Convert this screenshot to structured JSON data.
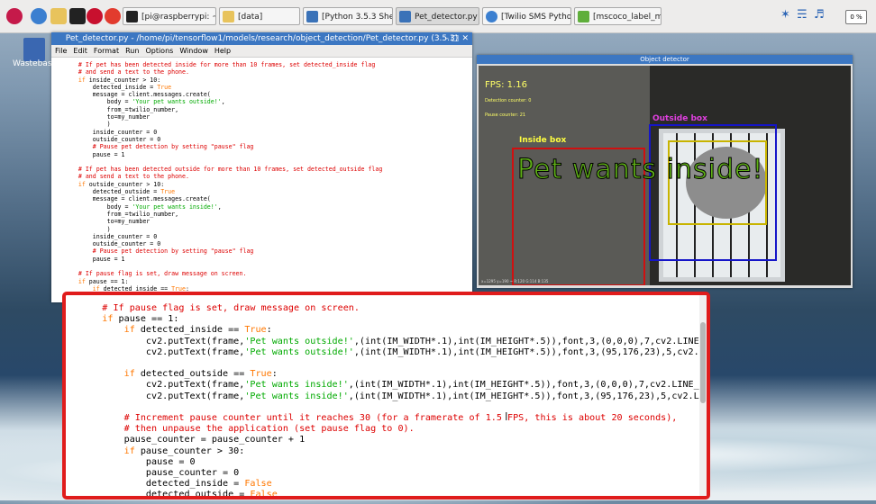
{
  "taskbar": {
    "tasks": [
      "[pi@raspberrypi: ~/te...",
      "[data]",
      "[Python 3.5.3 Shell]",
      "Pet_detector.py - /ho...",
      "[Twilio SMS Python Q...",
      "[mscoco_label_map.p..."
    ],
    "volume_label": "0 %"
  },
  "desktop": {
    "icon_label": "Wastebasket"
  },
  "editor": {
    "title": "Pet_detector.py - /home/pi/tensorflow1/models/research/object_detection/Pet_detector.py (3.5.3)",
    "menu": [
      "File",
      "Edit",
      "Format",
      "Run",
      "Options",
      "Window",
      "Help"
    ],
    "lines": [
      [
        [
          "c",
          "    # If pet has been detected inside for more than 10 frames, set detected_inside flag"
        ]
      ],
      [
        [
          "c",
          "    # and send a text to the phone."
        ]
      ],
      [
        [
          "k",
          "    if "
        ],
        [
          "n",
          "inside_counter > 10:"
        ]
      ],
      [
        [
          "n",
          "        detected_inside = "
        ],
        [
          "k",
          "True"
        ]
      ],
      [
        [
          "n",
          "        message = client.messages.create("
        ]
      ],
      [
        [
          "n",
          "            body = "
        ],
        [
          "s",
          "'Your pet wants outside!'"
        ],
        [
          "n",
          ","
        ]
      ],
      [
        [
          "n",
          "            from_=twilio_number,"
        ]
      ],
      [
        [
          "n",
          "            to=my_number"
        ]
      ],
      [
        [
          "n",
          "            )"
        ]
      ],
      [
        [
          "n",
          "        inside_counter = 0"
        ]
      ],
      [
        [
          "n",
          "        outside_counter = 0"
        ]
      ],
      [
        [
          "c",
          "        # Pause pet detection by setting \"pause\" flag"
        ]
      ],
      [
        [
          "n",
          "        pause = 1"
        ]
      ],
      [
        [
          "n",
          ""
        ]
      ],
      [
        [
          "c",
          "    # If pet has been detected outside for more than 10 frames, set detected_outside flag"
        ]
      ],
      [
        [
          "c",
          "    # and send a text to the phone."
        ]
      ],
      [
        [
          "k",
          "    if "
        ],
        [
          "n",
          "outside_counter > 10:"
        ]
      ],
      [
        [
          "n",
          "        detected_outside = "
        ],
        [
          "k",
          "True"
        ]
      ],
      [
        [
          "n",
          "        message = client.messages.create("
        ]
      ],
      [
        [
          "n",
          "            body = "
        ],
        [
          "s",
          "'Your pet wants inside!'"
        ],
        [
          "n",
          ","
        ]
      ],
      [
        [
          "n",
          "            from_=twilio_number,"
        ]
      ],
      [
        [
          "n",
          "            to=my_number"
        ]
      ],
      [
        [
          "n",
          "            )"
        ]
      ],
      [
        [
          "n",
          "        inside_counter = 0"
        ]
      ],
      [
        [
          "n",
          "        outside_counter = 0"
        ]
      ],
      [
        [
          "c",
          "        # Pause pet detection by setting \"pause\" flag"
        ]
      ],
      [
        [
          "n",
          "        pause = 1"
        ]
      ],
      [
        [
          "n",
          ""
        ]
      ],
      [
        [
          "c",
          "    # If pause flag is set, draw message on screen."
        ]
      ],
      [
        [
          "k",
          "    if "
        ],
        [
          "n",
          "pause == 1:"
        ]
      ],
      [
        [
          "k",
          "        if "
        ],
        [
          "n",
          "detected_inside == "
        ],
        [
          "k",
          "True"
        ],
        [
          "n",
          ":"
        ]
      ],
      [
        [
          "n",
          "            cv2.putText(frame,"
        ],
        [
          "s",
          "'Pet wants outside!'"
        ],
        [
          "n",
          ",(int(IM_WIDTH*.1),int(IM_HEIGHT*.5)),font,3,(0,0,0),7,cv2.LINE_A"
        ]
      ],
      [
        [
          "n",
          "            cv2.putText(frame,"
        ],
        [
          "s",
          "'Pet wants outside!'"
        ],
        [
          "n",
          ",(int(IM_WIDTH*.1),int(IM_HEIGHT*.5)),font,3,(95,176,23),5,cv2.L"
        ]
      ]
    ]
  },
  "detector": {
    "title": "Object detector",
    "fps": "FPS: 1.16",
    "detection_counter": "Detection counter: 0",
    "pause_counter": "Pause counter: 21",
    "outside_box_label": "Outside box",
    "inside_box_label": "Inside box",
    "message": "Pet wants inside!",
    "status": "x=1295 y=190 ~ R:120 G:114 B:135"
  },
  "callout": {
    "lines": [
      [
        [
          "c",
          "    # If pause flag is set, draw message on screen."
        ]
      ],
      [
        [
          "k",
          "    if "
        ],
        [
          "n",
          "pause == 1:"
        ]
      ],
      [
        [
          "k",
          "        if "
        ],
        [
          "n",
          "detected_inside == "
        ],
        [
          "k",
          "True"
        ],
        [
          "n",
          ":"
        ]
      ],
      [
        [
          "n",
          "            cv2.putText(frame,"
        ],
        [
          "s",
          "'Pet wants outside!'"
        ],
        [
          "n",
          ",(int(IM_WIDTH*.1),int(IM_HEIGHT*.5)),font,3,(0,0,0),7,cv2.LINE_A"
        ]
      ],
      [
        [
          "n",
          "            cv2.putText(frame,"
        ],
        [
          "s",
          "'Pet wants outside!'"
        ],
        [
          "n",
          ",(int(IM_WIDTH*.1),int(IM_HEIGHT*.5)),font,3,(95,176,23),5,cv2.L"
        ]
      ],
      [
        [
          "n",
          ""
        ]
      ],
      [
        [
          "k",
          "        if "
        ],
        [
          "n",
          "detected_outside == "
        ],
        [
          "k",
          "True"
        ],
        [
          "n",
          ":"
        ]
      ],
      [
        [
          "n",
          "            cv2.putText(frame,"
        ],
        [
          "s",
          "'Pet wants inside!'"
        ],
        [
          "n",
          ",(int(IM_WIDTH*.1),int(IM_HEIGHT*.5)),font,3,(0,0,0),7,cv2.LINE_A"
        ]
      ],
      [
        [
          "n",
          "            cv2.putText(frame,"
        ],
        [
          "s",
          "'Pet wants inside!'"
        ],
        [
          "n",
          ",(int(IM_WIDTH*.1),int(IM_HEIGHT*.5)),font,3,(95,176,23),5,cv2.LI"
        ]
      ],
      [
        [
          "n",
          ""
        ]
      ],
      [
        [
          "c",
          "        # Increment pause counter until it reaches 30 (for a framerate of 1.5 FPS, this is about 20 seconds),"
        ]
      ],
      [
        [
          "c",
          "        # then unpause the application (set pause flag to 0)."
        ]
      ],
      [
        [
          "n",
          "        pause_counter = pause_counter + 1"
        ]
      ],
      [
        [
          "k",
          "        if "
        ],
        [
          "n",
          "pause_counter > 30:"
        ]
      ],
      [
        [
          "n",
          "            pause = 0"
        ]
      ],
      [
        [
          "n",
          "            pause_counter = 0"
        ]
      ],
      [
        [
          "n",
          "            detected_inside = "
        ],
        [
          "k",
          "False"
        ]
      ],
      [
        [
          "n",
          "            detected_outside = "
        ],
        [
          "k",
          "False"
        ]
      ]
    ]
  },
  "colors": {
    "comment": "#dd0000",
    "keyword": "#ff7700",
    "string": "#00aa00",
    "callout_border": "#e01c1c",
    "title_bar": "#3c77c2"
  }
}
